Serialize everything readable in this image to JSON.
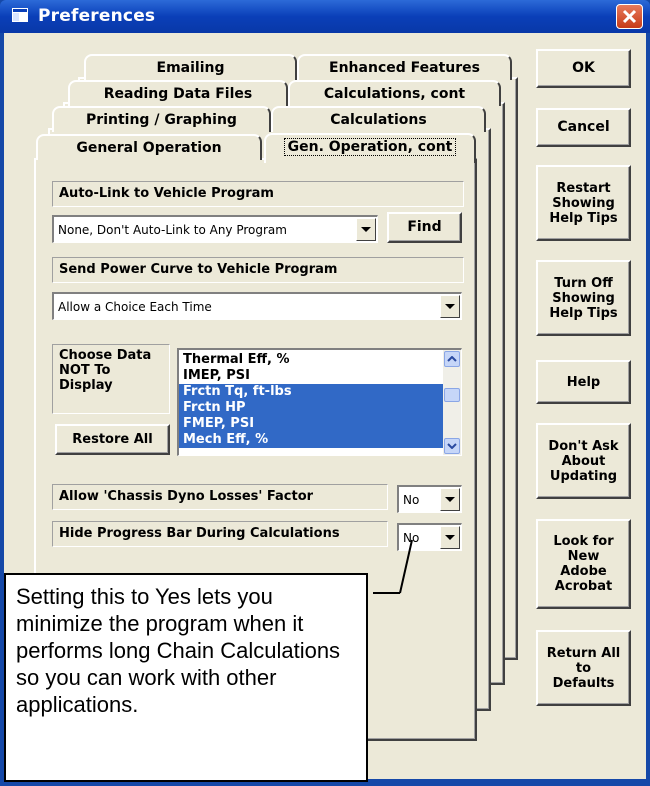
{
  "window": {
    "title": "Preferences",
    "close_glyph": "×"
  },
  "tabs": {
    "row1": [
      "Emailing",
      "Enhanced Features"
    ],
    "row2": [
      "Reading Data Files",
      "Calculations, cont"
    ],
    "row3": [
      "Printing / Graphing",
      "Calculations"
    ],
    "row4": [
      "General Operation",
      "Gen. Operation, cont"
    ],
    "active": "Gen. Operation, cont"
  },
  "panel": {
    "autolink_label": "Auto-Link to Vehicle Program",
    "autolink_value": "None, Don't Auto-Link to Any Program",
    "find_button": "Find",
    "sendcurve_label": "Send Power Curve to Vehicle Program",
    "sendcurve_value": "Allow a Choice Each Time",
    "choose_label_line1": "Choose Data",
    "choose_label_line2": "NOT To",
    "choose_label_line3": "Display",
    "restore_button": "Restore All",
    "data_list": [
      {
        "text": "Thermal Eff, %",
        "selected": false
      },
      {
        "text": "IMEP, PSI",
        "selected": false
      },
      {
        "text": "Frctn Tq, ft-lbs",
        "selected": true
      },
      {
        "text": "Frctn HP",
        "selected": true
      },
      {
        "text": "FMEP, PSI",
        "selected": true
      },
      {
        "text": "Mech Eff, %",
        "selected": true
      }
    ],
    "chassis_label": "Allow 'Chassis Dyno Losses' Factor",
    "chassis_value": "No",
    "progress_label": "Hide Progress Bar During Calculations",
    "progress_value": "No"
  },
  "side_buttons": {
    "ok": "OK",
    "cancel": "Cancel",
    "restart_tips": [
      "Restart",
      "Showing",
      "Help Tips"
    ],
    "turnoff_tips": [
      "Turn Off",
      "Showing",
      "Help Tips"
    ],
    "help": "Help",
    "dont_ask": [
      "Don't Ask",
      "About",
      "Updating"
    ],
    "acrobat": [
      "Look for",
      "New",
      "Adobe",
      "Acrobat"
    ],
    "return_defaults": [
      "Return All",
      "to",
      "Defaults"
    ]
  },
  "callout": {
    "text": "Setting this to Yes lets you minimize the program when it performs long Chain Calculations so you can work with other applications."
  },
  "colors": {
    "title_bar": "#0a3fb8",
    "dialog_bg": "#ece9d8",
    "selection": "#3169c6",
    "close_button": "#c73b18"
  }
}
